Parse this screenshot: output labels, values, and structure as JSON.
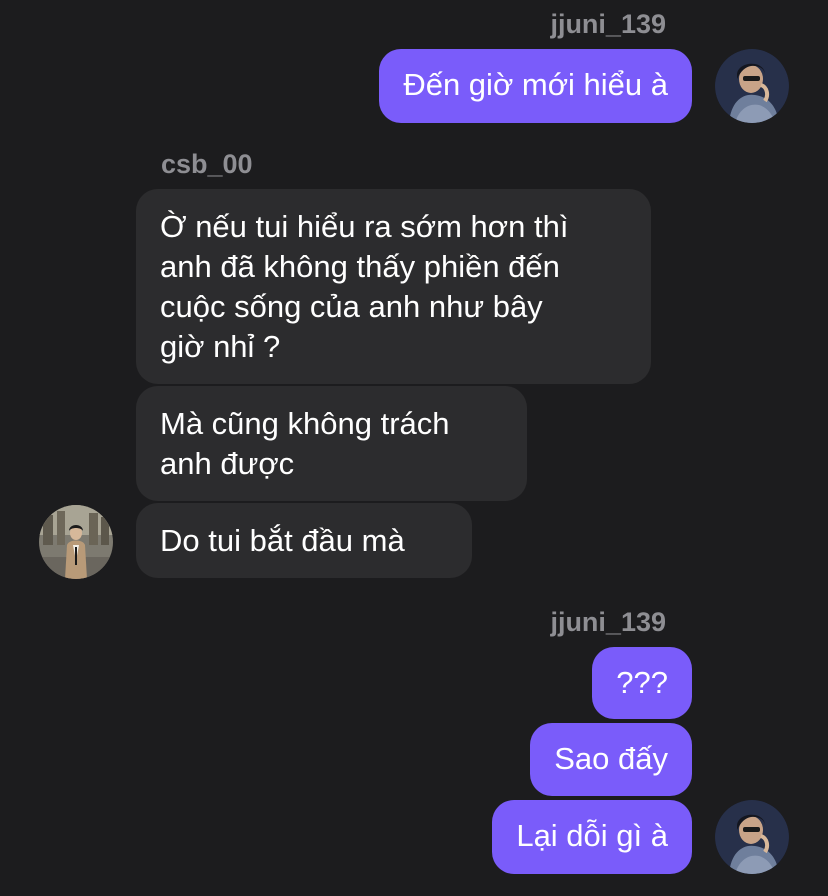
{
  "conversation": {
    "groups": [
      {
        "sender": "jjuni_139",
        "messages": [
          "Đến giờ mới hiểu à"
        ]
      },
      {
        "sender": "csb_00",
        "messages": [
          "Ờ nếu tui hiểu ra sớm hơn thì\nanh đã không thấy phiền đến\ncuộc sống của anh như bây\ngiờ nhỉ ?",
          "Mà cũng không trách\nanh được",
          "Do tui bắt đầu mà"
        ]
      },
      {
        "sender": "jjuni_139",
        "messages": [
          "???",
          "Sao đấy",
          "Lại dỗi gì à"
        ]
      }
    ]
  },
  "colors": {
    "background": "#1c1c1e",
    "outgoing_bubble": "#7a5cfa",
    "incoming_bubble": "#2c2c2e",
    "sender_name": "#8e8e93",
    "message_text": "#ffffff"
  }
}
